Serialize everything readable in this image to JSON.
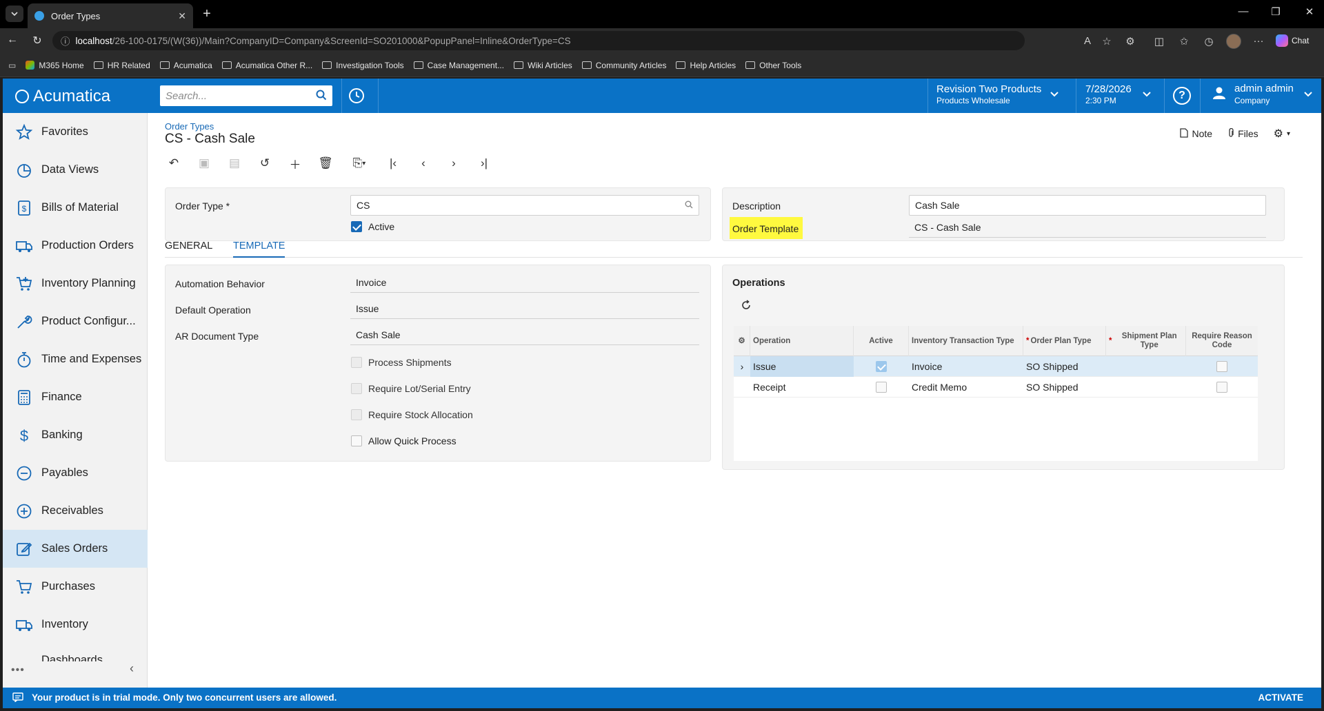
{
  "browser": {
    "tab_title": "Order Types",
    "url_host": "localhost",
    "url_rest": "/26-100-0175/(W(36))/Main?CompanyID=Company&ScreenId=SO201000&PopupPanel=Inline&OrderType=CS",
    "chat_label": "Chat",
    "bookmarks": [
      "M365 Home",
      "HR Related",
      "Acumatica",
      "Acumatica Other R...",
      "Investigation Tools",
      "Case Management...",
      "Wiki Articles",
      "Community Articles",
      "Help Articles",
      "Other Tools"
    ]
  },
  "header": {
    "logo": "Acumatica",
    "search_placeholder": "Search...",
    "company": "Revision Two Products",
    "branch": "Products Wholesale",
    "date": "7/28/2026",
    "time": "2:30 PM",
    "user": "admin admin",
    "user_company": "Company",
    "brand_color": "#0a72c6"
  },
  "sidebar": {
    "items": [
      {
        "label": "Favorites",
        "icon": "star-icon"
      },
      {
        "label": "Data Views",
        "icon": "pie-chart-icon"
      },
      {
        "label": "Bills of Material",
        "icon": "document-dollar-icon"
      },
      {
        "label": "Production Orders",
        "icon": "truck-icon"
      },
      {
        "label": "Inventory Planning",
        "icon": "cart-plus-icon"
      },
      {
        "label": "Product Configur...",
        "icon": "wrench-icon"
      },
      {
        "label": "Time and Expenses",
        "icon": "stopwatch-icon"
      },
      {
        "label": "Finance",
        "icon": "calculator-icon"
      },
      {
        "label": "Banking",
        "icon": "dollar-icon"
      },
      {
        "label": "Payables",
        "icon": "minus-circle-icon"
      },
      {
        "label": "Receivables",
        "icon": "plus-circle-icon"
      },
      {
        "label": "Sales Orders",
        "icon": "pencil-square-icon"
      },
      {
        "label": "Purchases",
        "icon": "cart-icon"
      },
      {
        "label": "Inventory",
        "icon": "truck-icon"
      },
      {
        "label": "Dashboards",
        "icon": "dashboard-icon"
      }
    ],
    "active_index": 11
  },
  "page": {
    "breadcrumb": "Order Types",
    "title": "CS - Cash Sale",
    "note_label": "Note",
    "files_label": "Files"
  },
  "summary": {
    "order_type_label": "Order Type",
    "order_type_value": "CS",
    "active_label": "Active",
    "active": true,
    "description_label": "Description",
    "description_value": "Cash Sale",
    "order_template_label": "Order Template",
    "order_template_value": "CS - Cash Sale"
  },
  "tabs": [
    {
      "label": "GENERAL",
      "active": false
    },
    {
      "label": "TEMPLATE",
      "active": true
    }
  ],
  "template": {
    "automation_behavior_label": "Automation Behavior",
    "automation_behavior_value": "Invoice",
    "default_operation_label": "Default Operation",
    "default_operation_value": "Issue",
    "ar_document_type_label": "AR Document Type",
    "ar_document_type_value": "Cash Sale",
    "checkboxes": [
      {
        "label": "Process Shipments",
        "checked": false
      },
      {
        "label": "Require Lot/Serial Entry",
        "checked": false
      },
      {
        "label": "Require Stock Allocation",
        "checked": false
      },
      {
        "label": "Allow Quick Process",
        "checked": false
      }
    ]
  },
  "operations": {
    "title": "Operations",
    "columns": [
      "Operation",
      "Active",
      "Inventory Transaction Type",
      "Order Plan Type",
      "Shipment Plan Type",
      "Require Reason Code"
    ],
    "rows": [
      {
        "operation": "Issue",
        "active": true,
        "inventory_transaction_type": "Invoice",
        "order_plan_type": "SO Shipped",
        "shipment_plan_type": "",
        "require_reason_code": false
      },
      {
        "operation": "Receipt",
        "active": false,
        "inventory_transaction_type": "Credit Memo",
        "order_plan_type": "SO Shipped",
        "shipment_plan_type": "",
        "require_reason_code": false
      }
    ]
  },
  "footer": {
    "message": "Your product is in trial mode. Only two concurrent users are allowed.",
    "activate_label": "ACTIVATE"
  }
}
